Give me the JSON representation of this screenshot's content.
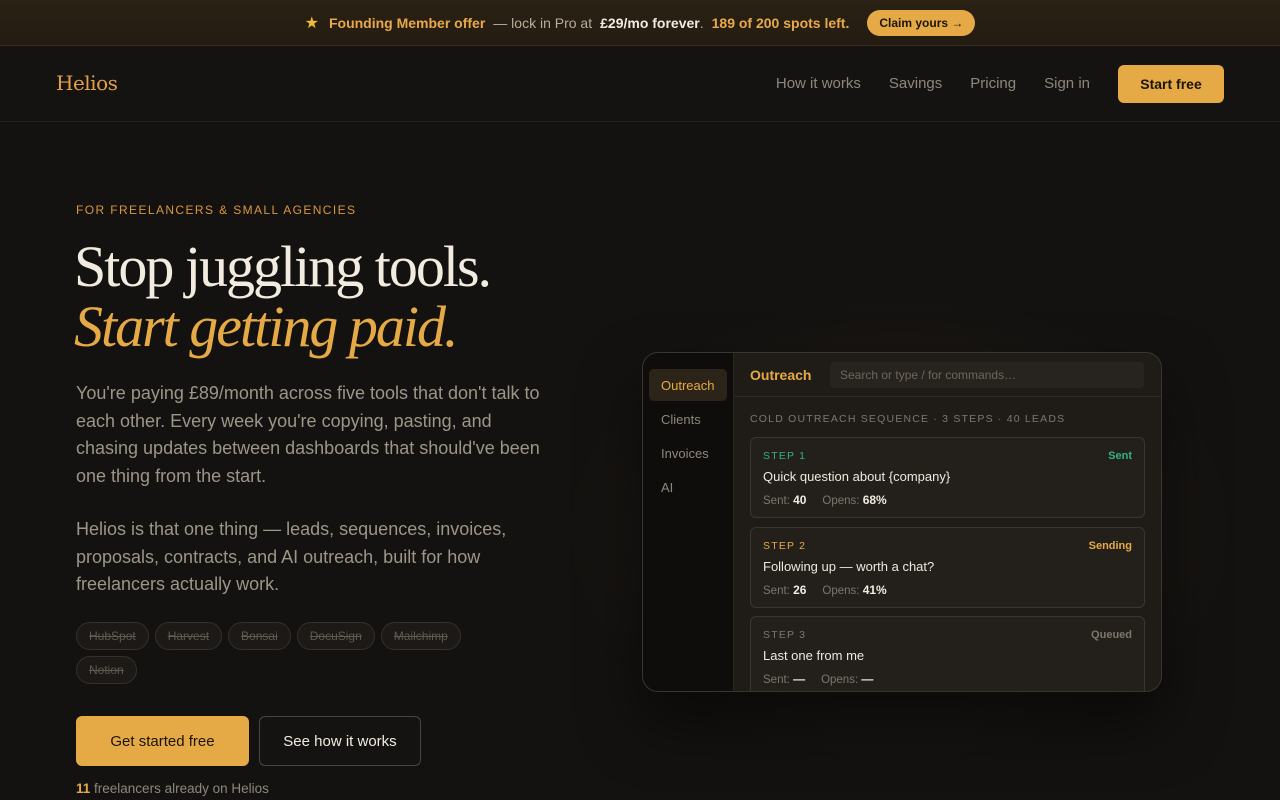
{
  "announce": {
    "star_icon": "★",
    "offer_label": "Founding Member offer",
    "dash_text": "— lock in Pro at",
    "price": "£29/mo forever",
    "period": ".",
    "spots": "189 of 200 spots left.",
    "claim_button": "Claim yours →"
  },
  "nav": {
    "logo": "Helios",
    "links": [
      "How it works",
      "Savings",
      "Pricing",
      "Sign in"
    ],
    "start_button": "Start free"
  },
  "hero": {
    "eyebrow": "FOR FREELANCERS & SMALL AGENCIES",
    "headline_1": "Stop juggling tools.",
    "headline_2": "Start getting paid.",
    "para_1": "You're paying £89/month across five tools that don't talk to each other. Every week you're copying, pasting, and chasing updates between dashboards that should've been one thing from the start.",
    "para_2": "Helios is that one thing — leads, sequences, invoices, proposals, contracts, and AI outreach, built for how freelancers actually work.",
    "replaced_tools": [
      "HubSpot",
      "Harvest",
      "Bonsai",
      "DocuSign",
      "Mailchimp",
      "Notion"
    ],
    "cta_primary": "Get started free",
    "cta_secondary": "See how it works",
    "social_count": "11",
    "social_text": " freelancers already on Helios"
  },
  "app": {
    "sidebar": [
      "Outreach",
      "Clients",
      "Invoices",
      "AI"
    ],
    "active_item": "Outreach",
    "title": "Outreach",
    "search_placeholder": "Search or type / for commands…",
    "sequence_heading": "COLD OUTREACH SEQUENCE · 3 STEPS · 40 LEADS",
    "steps": [
      {
        "label": "STEP 1",
        "status": "Sent",
        "subject": "Quick question about {company}",
        "sent_label": "Sent:",
        "sent": "40",
        "opens_label": "Opens:",
        "opens": "68%",
        "color": "#35b37e"
      },
      {
        "label": "STEP 2",
        "status": "Sending",
        "subject": "Following up — worth a chat?",
        "sent_label": "Sent:",
        "sent": "26",
        "opens_label": "Opens:",
        "opens": "41%",
        "color": "#e5aa45"
      },
      {
        "label": "STEP 3",
        "status": "Queued",
        "subject": "Last one from me",
        "sent_label": "Sent:",
        "sent": "—",
        "opens_label": "Opens:",
        "opens": "—",
        "color": "#7d766b"
      }
    ]
  },
  "colors": {
    "accent": "#e5aa45",
    "background": "#141210",
    "success": "#35b37e"
  }
}
